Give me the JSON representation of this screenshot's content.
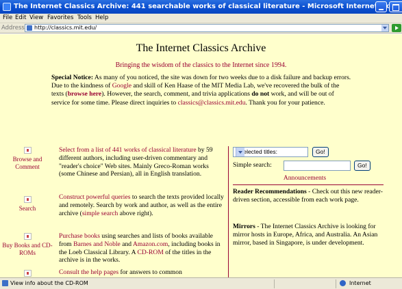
{
  "window": {
    "title": "The Internet Classics Archive: 441 searchable works of classical literature - Microsoft Internet Explorer"
  },
  "menu": [
    "File",
    "Edit",
    "View",
    "Favorites",
    "Tools",
    "Help"
  ],
  "address": {
    "label": "Address",
    "url": "http://classics.mit.edu/"
  },
  "page": {
    "title": "The Internet Classics Archive",
    "tagline": "Bringing the wisdom of the classics to the Internet since 1994.",
    "notice": {
      "label": "Special Notice:",
      "text1": " As many of you noticed, the site was down for two weeks due to a disk failure and backup errors. Due to the kindness of ",
      "google_link": "Google",
      "text2": " and skill of Ken Haase of the MIT Media Lab, we've recovered the bulk of the texts (",
      "browse_link": "browse here",
      "text3": "). However, the search, comment, and trivia applications ",
      "do_not": "do not",
      "text4": " work, and will be out of service for some time. Please direct inquiries to ",
      "email_link": "classics@classics.mit.edu",
      "text5": ". Thank you for your patience."
    },
    "features": [
      {
        "caption": "Browse and Comment",
        "link": "Select from a list of 441 works of classical literature",
        "text": " by 59 different authors, including user-driven commentary and \"reader's choice\" Web sites. Mainly Greco-Roman works (some Chinese and Persian), all in English translation."
      },
      {
        "caption": "Search",
        "link": "Construct powerful queries",
        "text": " to search the texts provided locally and remotely. Search by work and author, as well as the entire archive (",
        "link2": "simple search",
        "text2": " above right)."
      },
      {
        "caption": "Buy Books and CD-ROMs",
        "link": "Purchase books",
        "text": " using searches and lists of books available from ",
        "link2": "Barnes and Noble",
        "text2": " and ",
        "link3": "Amazon.com",
        "text3": ", including books in the Loeb Classical Library. A ",
        "link4": "CD-ROM",
        "text4": " of the titles in the archive is in the works."
      },
      {
        "caption": "",
        "link": "Consult the help pages",
        "text": " for answers to common"
      }
    ],
    "sidebar": {
      "select_value": "* Selected titles:",
      "go_label": "Go!",
      "search_label": "Simple search:",
      "search_value": "",
      "announcements": "Announcements",
      "reader_rec_title": "Reader Recommendations",
      "reader_rec_text": " - Check out this new reader-driven section, accessible from each work page.",
      "mirrors_title": "Mirrors",
      "mirrors_text": " - The Internet Classics Archive is looking for mirror hosts in Europe, Africa, and Australia. An Asian mirror, based in Singapore, is under development."
    }
  },
  "status": {
    "text": "View info about the CD-ROM",
    "zone": "Internet"
  },
  "colors": {
    "accent_link": "#990033",
    "page_background": "#ffffcc",
    "titlebar": "#0a4fd0"
  }
}
